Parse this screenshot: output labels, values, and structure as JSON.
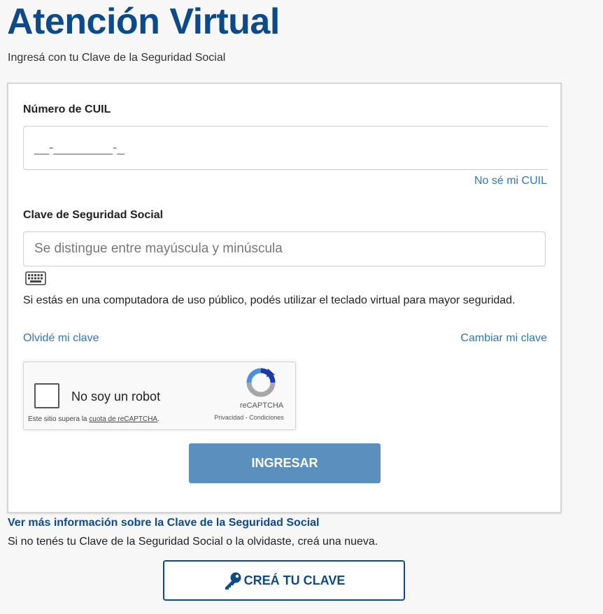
{
  "header": {
    "title": "Atención Virtual",
    "subtitle": "Ingresá con tu Clave de la Seguridad Social"
  },
  "form": {
    "cuil_label": "Número de CUIL",
    "cuil_placeholder": "__-________-_",
    "cuil_help_link": "No sé mi CUIL",
    "password_label": "Clave de Seguridad Social",
    "password_placeholder": "Se distingue entre mayúscula y minúscula",
    "keyboard_icon": "keyboard-icon",
    "virtual_keyboard_notice": "Si estás en una computadora de uso público, podés utilizar el teclado virtual para mayor seguridad.",
    "forgot_link": "Olvidé mi clave",
    "change_link": "Cambiar mi clave",
    "submit_label": "INGRESAR"
  },
  "recaptcha": {
    "checkbox_label": "No soy un robot",
    "brand": "reCAPTCHA",
    "privacy": "Privacidad",
    "separator": " - ",
    "terms": "Condiciones",
    "quota_prefix": "Este sitio supera la ",
    "quota_link": "cuota de reCAPTCHA",
    "quota_suffix": "."
  },
  "footer": {
    "more_info_link": "Ver más información sobre la Clave de la Seguridad Social",
    "help_text": "Si no tenés tu Clave de la Seguridad Social o la olvidaste, creá una nueva.",
    "create_button": "CREÁ TU CLAVE"
  },
  "colors": {
    "brand_blue": "#0d4a89",
    "link_blue": "#2e78b8",
    "button_blue": "#5b8fbe"
  }
}
